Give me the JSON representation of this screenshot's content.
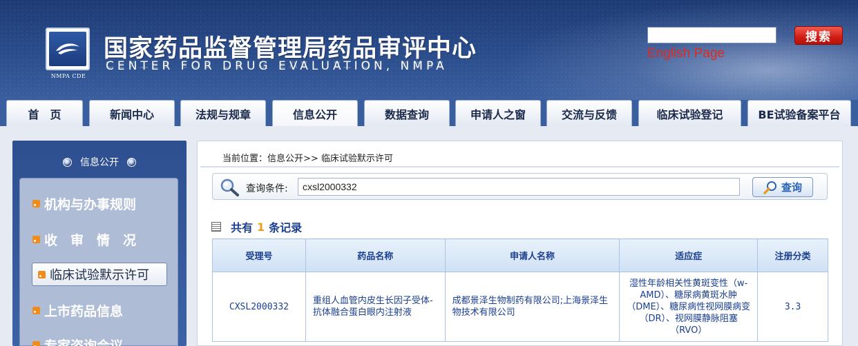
{
  "header": {
    "logo_caption": "NMPA CDE",
    "title": "国家药品监督管理局药品审评中心",
    "subtitle": "CENTER FOR DRUG EVALUATION, NMPA",
    "search_placeholder": "",
    "search_button": "搜索",
    "english_link": "English Page"
  },
  "nav": {
    "tabs": [
      {
        "label": "首　页"
      },
      {
        "label": "新闻中心"
      },
      {
        "label": "法规与规章"
      },
      {
        "label": "信息公开"
      },
      {
        "label": "数据查询"
      },
      {
        "label": "申请人之窗"
      },
      {
        "label": "交流与反馈"
      },
      {
        "label": "临床试验登记"
      },
      {
        "label": "BE试验备案平台"
      }
    ],
    "active_index": 3
  },
  "sidebar": {
    "heading": "信息公开",
    "items": [
      {
        "label": "机构与办事规则"
      },
      {
        "label": "收　审　情　况"
      },
      {
        "label": "临床试验默示许可"
      },
      {
        "label": "上市药品信息"
      },
      {
        "label": "专家咨询会议"
      }
    ],
    "active_index": 2
  },
  "main": {
    "breadcrumb": "当前位置：信息公开>> 临床试验默示许可",
    "query_label": "查询条件:",
    "query_value": "cxsl2000332",
    "query_button": "查询",
    "result_prefix": "共有",
    "result_count": "1",
    "result_suffix": "条记录"
  },
  "table": {
    "headers": [
      "受理号",
      "药品名称",
      "申请人名称",
      "适应症",
      "注册分类"
    ],
    "rows": [
      {
        "accept_no": "CXSL2000332",
        "drug_name": "重组人血管内皮生长因子受体-抗体融合蛋白眼内注射液",
        "applicant": "成都景泽生物制药有限公司;上海景泽生物技术有限公司",
        "indication": "湿性年龄相关性黄斑变性（w-AMD）、糖尿病黄斑水肿（DME）、糖尿病性视网膜病变（DR）、视网膜静脉阻塞（RVO）",
        "category": "3.3"
      }
    ]
  },
  "colors": {
    "header_blue": "#2b4d8c",
    "link_red": "#e02a1e",
    "table_text": "#1a3f8f",
    "count_orange": "#f29a1a"
  }
}
